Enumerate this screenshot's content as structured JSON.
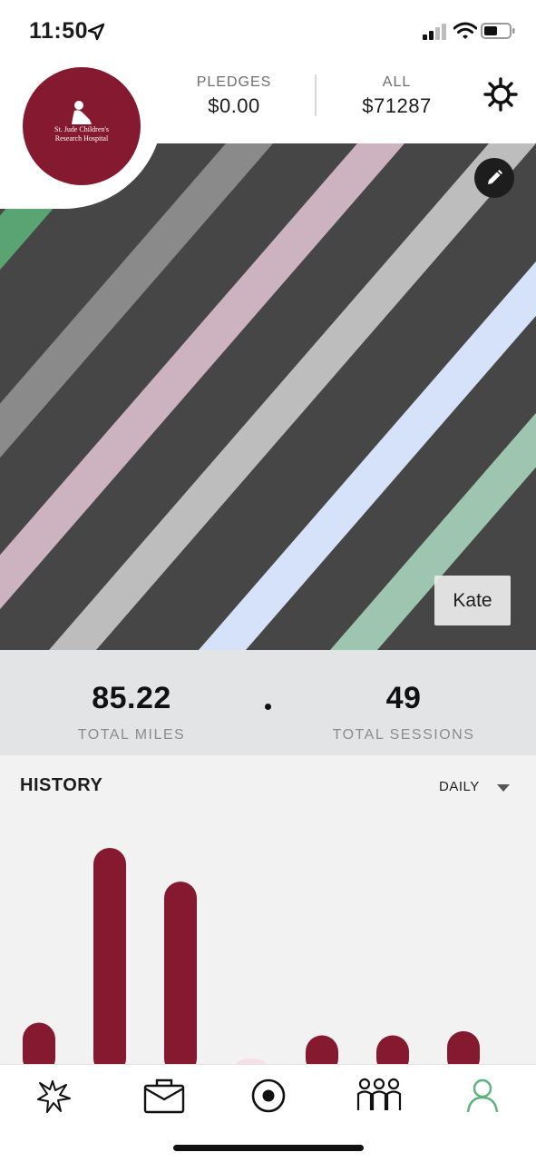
{
  "status_bar": {
    "time": "11:50"
  },
  "header": {
    "pledges_label": "PLEDGES",
    "pledges_value": "$0.00",
    "all_label": "ALL",
    "all_value": "$71287"
  },
  "logo": {
    "line1": "St. Jude Children's",
    "line2": "Research Hospital"
  },
  "hero": {
    "name_tag": "Kate"
  },
  "totals": {
    "miles_value": "85.22",
    "miles_label": "TOTAL MILES",
    "sessions_value": "49",
    "sessions_label": "TOTAL SESSIONS"
  },
  "history": {
    "title": "HISTORY",
    "filter": "DAILY",
    "bar_color": "#85192f"
  },
  "chart_data": {
    "type": "bar",
    "categories": [],
    "values": [
      0.17,
      1.0,
      0.84,
      0.0,
      0.11,
      0.11,
      0.13
    ],
    "title": "HISTORY"
  },
  "tabbar": {
    "items": [
      {
        "icon": "burst-icon",
        "label": ""
      },
      {
        "icon": "briefcase-icon",
        "label": ""
      },
      {
        "icon": "record-icon",
        "label": ""
      },
      {
        "icon": "team-icon",
        "label": ""
      },
      {
        "icon": "profile-icon",
        "label": "",
        "active": true
      }
    ]
  },
  "colors": {
    "brand": "#85192f",
    "hero_bg": "#464646",
    "active_tab": "#5ab37b",
    "stripe_green": "#5aa372",
    "stripe_gray": "#8a8a8a",
    "stripe_pink": "#cdb3bf",
    "stripe_light": "#bdbdbd",
    "stripe_blue": "#d6e2fa",
    "stripe_mint": "#9ec5b0"
  }
}
